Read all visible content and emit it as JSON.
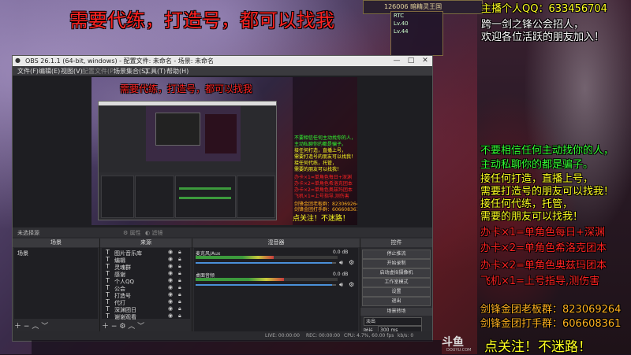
{
  "headline": "需要代练，打造号，都可以找我",
  "game_topbar_text": "126006 暗精灵王国",
  "game_ui": [
    "RTC",
    "Lv.40",
    "Lv.44"
  ],
  "right_panel": {
    "top_lines": [
      {
        "text": "主播个人QQ：633456704",
        "color": "yellow"
      },
      {
        "text": "跨一剑之锋公会招人，",
        "color": "white"
      },
      {
        "text": "欢迎各位活跃的朋友加入！",
        "color": "white"
      }
    ],
    "middle_lines": [
      {
        "text": "不要相信任何主动找你的人，",
        "color": "green"
      },
      {
        "text": "主动私聊你的都是骗子。",
        "color": "green"
      },
      {
        "text": "接任何打造，直播上号，",
        "color": "yellow"
      },
      {
        "text": "需要打造号的朋友可以找我！",
        "color": "yellow"
      },
      {
        "text": "接任何代练，托管，",
        "color": "yellow"
      },
      {
        "text": "需要的朋友可以找我！",
        "color": "yellow"
      }
    ],
    "price_lines": [
      {
        "text": "办卡×1=单角色每日+深渊",
        "color": "red"
      },
      {
        "text": "办卡×2=单角色希洛克团本",
        "color": "red"
      },
      {
        "text": "办卡×2=单角色奥兹玛团本",
        "color": "red"
      },
      {
        "text": "飞机×1=上号指导,测伤害",
        "color": "red"
      }
    ],
    "group_lines": [
      {
        "text": "剑锋金团老板群：823069264",
        "color": "orange"
      },
      {
        "text": "剑锋金团打手群：606608361",
        "color": "orange"
      }
    ],
    "footer": "点关注！不迷路！"
  },
  "obs": {
    "title": "OBS 26.1.1 (64-bit, windows) - 配置文件: 未命名 - 场景: 未命名",
    "menu": [
      "文件(F)",
      "编辑(E)",
      "视图(V)",
      "配置文件(P)",
      "场景集合(S)",
      "工具(T)",
      "帮助(H)"
    ],
    "preview_headline": "需要代练，打造号，都可以找我",
    "preview_right_lines": [
      "不要相信任何主动找你的人，",
      "主动私聊你的都是骗子。",
      "接任何打造，直播上号，",
      "需要打造号的朋友可以找我！",
      "接任何代练，托管，",
      "需要的朋友可以找我！",
      "办卡×1=单角色每日+深渊",
      "办卡×2=单角色希洛克团本",
      "办卡×2=单角色奥兹玛团本",
      "飞机×1=上号指导,测伤害",
      "剑锋金团老板群：823069264",
      "剑锋金团打手群：606608361"
    ],
    "preview_footer": "点关注！不迷路！",
    "no_source": "未选择源",
    "toolbar": {
      "properties": "属性",
      "filters": "滤镜"
    },
    "docks": {
      "scenes": {
        "title": "场景",
        "items": [
          "场景"
        ]
      },
      "sources": {
        "title": "来源",
        "items": [
          "图片音乐库",
          "编辑",
          "灵魂群",
          "感谢",
          "个人QQ",
          "公会",
          "打造号",
          "代打",
          "深渊团日",
          "谢谢观看"
        ]
      },
      "mixer": {
        "title": "混音器",
        "channels": [
          {
            "name": "桌面音频",
            "db": "0.0 dB",
            "level": 0.62
          },
          {
            "name": "麦克风/Aux",
            "db": "0.0 dB",
            "level": 0.55
          }
        ]
      },
      "controls": {
        "title": "控件",
        "buttons": [
          "停止推流",
          "开始录制",
          "启动虚拟摄像机",
          "工作室模式",
          "设置",
          "退出"
        ]
      },
      "transitions": {
        "title": "场景转场",
        "type": "淡出",
        "duration_label": "时长",
        "duration": "300 ms"
      }
    },
    "status": {
      "live": "LIVE: 00:00:00",
      "rec": "REC: 00:00:00",
      "cpu": "CPU: 4.7%, 60.00 fps",
      "bitrate": "kb/s: 0"
    }
  },
  "douyu": {
    "logo": "斗鱼",
    "sub": "DOUYU.COM"
  }
}
